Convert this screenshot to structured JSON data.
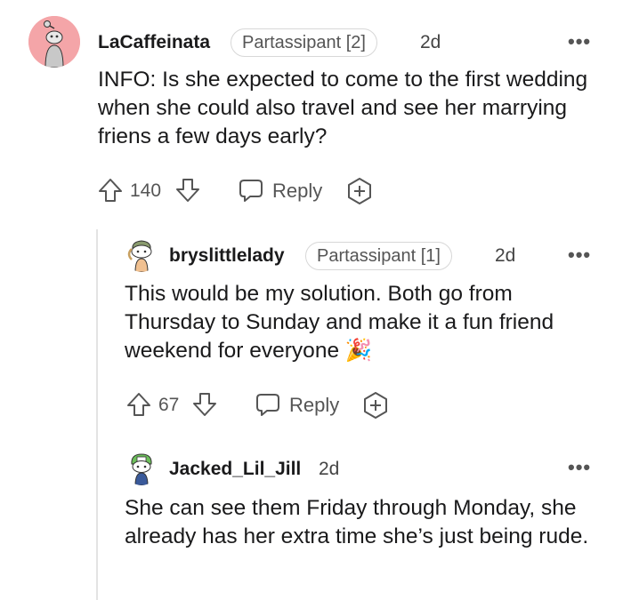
{
  "comments": [
    {
      "username": "LaCaffeinata",
      "flair": "Partassipant [2]",
      "time": "2d",
      "body": "INFO: Is she expected to come to the first wedding when she could also travel and see her marrying friens a few days early?",
      "votes": "140",
      "reply_label": "Reply"
    },
    {
      "username": "bryslittlelady",
      "flair": "Partassipant [1]",
      "time": "2d",
      "body": "This would be my solution. Both go from Thursday to Sunday and make it a fun friend weekend for everyone 🎉",
      "votes": "67",
      "reply_label": "Reply"
    },
    {
      "username": "Jacked_Lil_Jill",
      "time": "2d",
      "body": "She can see them Friday through Monday, she already has her extra time she’s just being rude."
    }
  ],
  "more_icon": "•••",
  "colors": {
    "avatar_bg": "#f4a5a8",
    "muted": "#555555",
    "thread_line": "#e3e3e3"
  }
}
